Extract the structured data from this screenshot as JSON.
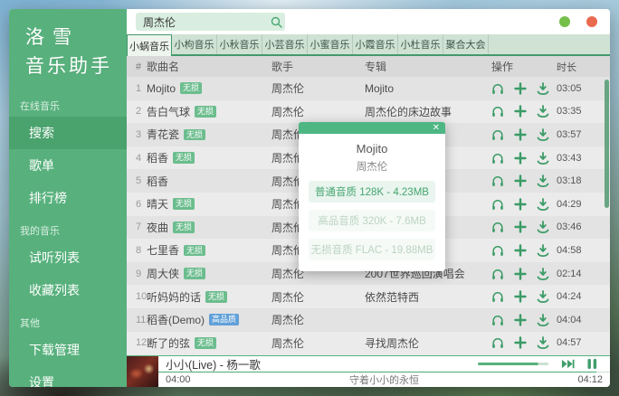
{
  "app": {
    "logo_line1": "洛雪",
    "logo_line2": "音乐助手"
  },
  "search": {
    "value": "周杰伦"
  },
  "window_controls": {
    "minimize_icon": "green-dot",
    "close_icon": "red-dot"
  },
  "sidebar": {
    "sections": [
      {
        "label": "在线音乐",
        "items": [
          {
            "key": "search",
            "label": "搜索",
            "active": true
          },
          {
            "key": "songlist",
            "label": "歌单",
            "active": false
          },
          {
            "key": "leaderboard",
            "label": "排行榜",
            "active": false
          }
        ]
      },
      {
        "label": "我的音乐",
        "items": [
          {
            "key": "listen-list",
            "label": "试听列表",
            "active": false
          },
          {
            "key": "collect-list",
            "label": "收藏列表",
            "active": false
          }
        ]
      },
      {
        "label": "其他",
        "items": [
          {
            "key": "download-manager",
            "label": "下载管理",
            "active": false
          },
          {
            "key": "settings",
            "label": "设置",
            "active": false
          }
        ]
      }
    ]
  },
  "tabs": [
    {
      "key": "xiaowo",
      "label": "小蜗音乐",
      "active": true
    },
    {
      "key": "xiaogou",
      "label": "小枸音乐",
      "active": false
    },
    {
      "key": "xiaoqiu",
      "label": "小秋音乐",
      "active": false
    },
    {
      "key": "xiaoyun",
      "label": "小芸音乐",
      "active": false
    },
    {
      "key": "xiaomi",
      "label": "小蜜音乐",
      "active": false
    },
    {
      "key": "xiaoxia",
      "label": "小霞音乐",
      "active": false
    },
    {
      "key": "xiaodu",
      "label": "小杜音乐",
      "active": false
    },
    {
      "key": "juhe",
      "label": "聚合大会",
      "active": false
    }
  ],
  "table": {
    "headers": [
      "#",
      "歌曲名",
      "歌手",
      "专辑",
      "操作",
      "时长"
    ],
    "rows": [
      {
        "num": "1",
        "name": "Mojito",
        "badge": "无损",
        "badge_type": "green",
        "artist": "周杰伦",
        "album": "Mojito",
        "duration": "03:05"
      },
      {
        "num": "2",
        "name": "告白气球",
        "badge": "无损",
        "badge_type": "green",
        "artist": "周杰伦",
        "album": "周杰伦的床边故事",
        "duration": "03:35"
      },
      {
        "num": "3",
        "name": "青花瓷",
        "badge": "无损",
        "badge_type": "green",
        "artist": "周杰伦",
        "album": "",
        "duration": "03:57"
      },
      {
        "num": "4",
        "name": "稻香",
        "badge": "无损",
        "badge_type": "green",
        "artist": "周杰伦",
        "album": "",
        "duration": "03:43"
      },
      {
        "num": "5",
        "name": "稻香",
        "badge": "",
        "badge_type": "",
        "artist": "周杰伦",
        "album": "",
        "duration": "03:18"
      },
      {
        "num": "6",
        "name": "晴天",
        "badge": "无损",
        "badge_type": "green",
        "artist": "周杰伦",
        "album": "",
        "duration": "04:29"
      },
      {
        "num": "7",
        "name": "夜曲",
        "badge": "无损",
        "badge_type": "green",
        "artist": "周杰伦",
        "album": "",
        "duration": "03:46"
      },
      {
        "num": "8",
        "name": "七里香",
        "badge": "无损",
        "badge_type": "green",
        "artist": "周杰伦",
        "album": "",
        "duration": "04:58"
      },
      {
        "num": "9",
        "name": "周大侠",
        "badge": "无损",
        "badge_type": "green",
        "artist": "周杰伦",
        "album": "2007世界巡回演唱会",
        "duration": "02:14"
      },
      {
        "num": "10",
        "name": "听妈妈的话",
        "badge": "无损",
        "badge_type": "green",
        "artist": "周杰伦",
        "album": "依然范特西",
        "duration": "04:24"
      },
      {
        "num": "11",
        "name": "稻香(Demo)",
        "badge": "高品质",
        "badge_type": "blue",
        "artist": "周杰伦",
        "album": "",
        "duration": "04:04"
      },
      {
        "num": "12",
        "name": "断了的弦",
        "badge": "无损",
        "badge_type": "green",
        "artist": "周杰伦",
        "album": "寻找周杰伦",
        "duration": "04:57"
      }
    ]
  },
  "modal": {
    "title": "Mojito",
    "artist": "周杰伦",
    "close_icon": "✕",
    "options": [
      {
        "label": "普通音质 128K - 4.23MB",
        "enabled": true
      },
      {
        "label": "高品音质 320K - 7.6MB",
        "enabled": false
      },
      {
        "label": "无损音质 FLAC - 19.88MB",
        "enabled": false
      }
    ]
  },
  "player": {
    "song": "小小(Live) - 杨一歌",
    "current_time": "04:00",
    "total_time": "04:12",
    "lyric": "守着小小的永恒",
    "progress_percent": 97,
    "volume_percent": 85
  },
  "icons": {
    "search": "magnifier",
    "preview": "headphones",
    "add": "plus",
    "download": "download-arrow",
    "next": "next-track",
    "pause": "pause-bars"
  },
  "colors": {
    "sidebar_green": "#58b17d",
    "accent_green": "#3f9e6a",
    "modal_header_green": "#4db683",
    "badge_lossless": "#6cbd8e",
    "badge_hq": "#61a0d8",
    "minimize_dot": "#76bf4b",
    "close_dot": "#e96a4f"
  }
}
